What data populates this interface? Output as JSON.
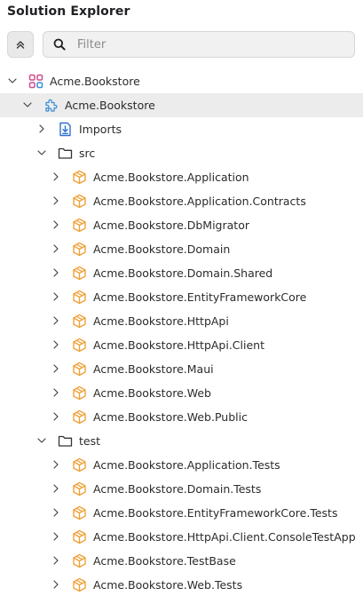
{
  "header": {
    "title": "Solution Explorer",
    "filter_placeholder": "Filter"
  },
  "tree": {
    "solution": {
      "label": "Acme.Bookstore",
      "icon": "solution-icon"
    },
    "project": {
      "label": "Acme.Bookstore",
      "icon": "project-icon"
    },
    "imports": {
      "label": "Imports",
      "icon": "imports-icon"
    },
    "src_folder": {
      "label": "src",
      "icon": "folder-icon",
      "items": [
        "Acme.Bookstore.Application",
        "Acme.Bookstore.Application.Contracts",
        "Acme.Bookstore.DbMigrator",
        "Acme.Bookstore.Domain",
        "Acme.Bookstore.Domain.Shared",
        "Acme.Bookstore.EntityFrameworkCore",
        "Acme.Bookstore.HttpApi",
        "Acme.Bookstore.HttpApi.Client",
        "Acme.Bookstore.Maui",
        "Acme.Bookstore.Web",
        "Acme.Bookstore.Web.Public"
      ]
    },
    "test_folder": {
      "label": "test",
      "icon": "folder-icon",
      "items": [
        "Acme.Bookstore.Application.Tests",
        "Acme.Bookstore.Domain.Tests",
        "Acme.Bookstore.EntityFrameworkCore.Tests",
        "Acme.Bookstore.HttpApi.Client.ConsoleTestApp",
        "Acme.Bookstore.TestBase",
        "Acme.Bookstore.Web.Tests"
      ]
    }
  },
  "colors": {
    "module_icon": "#f0a13a",
    "solution_icon": "#d14a8b",
    "project_icon": "#3b8fd9",
    "imports_icon": "#2f6fd1",
    "selected_row": "#ececec"
  }
}
